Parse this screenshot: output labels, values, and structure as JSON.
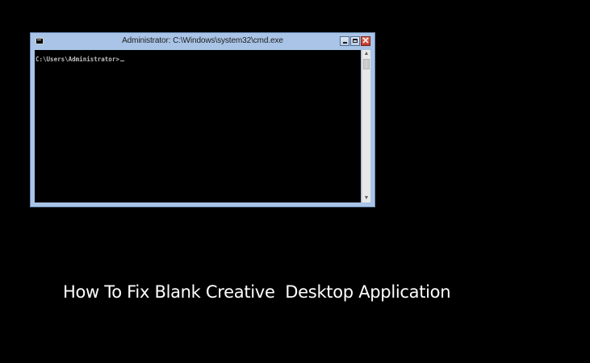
{
  "window": {
    "title": "Administrator: C:\\Windows\\system32\\cmd.exe",
    "app_icon": "cmd-icon",
    "controls": {
      "minimize_icon": "minimize-icon",
      "maximize_icon": "maximize-icon",
      "close_icon": "close-icon",
      "close_glyph": "✕"
    },
    "colors": {
      "frame": "#a9c4e6",
      "console_bg": "#000000",
      "console_text": "#c0c0c0",
      "close_button": "#c0392b"
    }
  },
  "console": {
    "prompt": "C:\\Users\\Administrator>"
  },
  "scrollbar": {
    "up_arrow": "▲",
    "down_arrow": "▼"
  },
  "caption": {
    "text": "How To Fix Blank Creative  Desktop Application"
  },
  "page": {
    "background": "#000000"
  }
}
